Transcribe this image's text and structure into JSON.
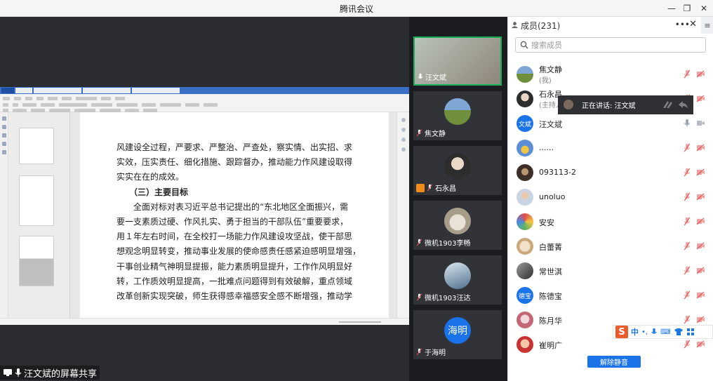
{
  "window": {
    "title": "腾讯会议",
    "minimize_glyph": "—",
    "restore_glyph": "❐",
    "close_glyph": "✕"
  },
  "share": {
    "label": "汪文斌的屏幕共享"
  },
  "document": {
    "lines": [
      {
        "text": "风建设全过程，严要求、严整治、严查处，察实情、出实招、求",
        "bold": false
      },
      {
        "text": "实效，压实责任、细化措施、跟踪督办，推动能力作风建设取得",
        "bold": false
      },
      {
        "text": "实实在在的成效。",
        "bold": false
      },
      {
        "text": "　　（三）主要目标",
        "bold": true
      },
      {
        "text": "　　全面对标对表习近平总书记提出的“东北地区全面振兴，需",
        "bold": false
      },
      {
        "text": "要一支素质过硬、作风扎实、勇于担当的干部队伍”重要要求，",
        "bold": false
      },
      {
        "text": "用１年左右时间，在全校打一场能力作风建设攻坚战，使干部思",
        "bold": false
      },
      {
        "text": "想观念明显转变，推动事业发展的使命感责任感紧迫感明显增强，",
        "bold": false
      },
      {
        "text": "干事创业精气神明显提振，能力素质明显提升，工作作风明显好",
        "bold": false
      },
      {
        "text": "转，工作质效明显提高，一批难点问题得到有效破解，重点领域",
        "bold": false
      },
      {
        "text": "改革创新实现突破，师生获得感幸福感安全感不断增强，推动学",
        "bold": false
      }
    ]
  },
  "videos": [
    {
      "name": "汪文斌",
      "icon": "mic-icon",
      "active": true
    },
    {
      "name": "焦文静",
      "icon": "mic-muted-icon",
      "active": false
    },
    {
      "name": "石永昌",
      "icon": "mic-muted-icon",
      "active": false,
      "badge": "share-icon"
    },
    {
      "name": "微机1903李畅",
      "icon": "mic-muted-icon",
      "active": false
    },
    {
      "name": "微机1903汪达",
      "icon": "mic-muted-icon",
      "active": false
    },
    {
      "name": "于海明",
      "icon": "mic-muted-icon",
      "active": false,
      "avatar_text": "海明"
    }
  ],
  "panel": {
    "title": "成员(231)",
    "more": "•••",
    "close": "✕",
    "side_toggle": "≡",
    "search_placeholder": "搜索成员",
    "unmute_label": "解除静音",
    "speaking_label": "正在讲话: 汪文斌",
    "members": [
      {
        "name": "焦文静",
        "sub": "(我)",
        "avatar": "photo-field",
        "mic": "muted"
      },
      {
        "name": "石永昌",
        "sub": "(主持人)",
        "avatar": "photo-person-f",
        "mic": "muted"
      },
      {
        "name": "汪文斌",
        "sub": "",
        "avatar": "text",
        "avatar_text": "文斌",
        "mic": "active"
      },
      {
        "name": "......",
        "sub": "",
        "avatar": "photo-cartoon",
        "mic": "muted"
      },
      {
        "name": "093113-2",
        "sub": "",
        "avatar": "photo-dark",
        "mic": "muted"
      },
      {
        "name": "unoluo",
        "sub": "",
        "avatar": "photo-person-m",
        "mic": "muted"
      },
      {
        "name": "安安",
        "sub": "",
        "avatar": "photo-colorful",
        "mic": "muted"
      },
      {
        "name": "白蕾菁",
        "sub": "",
        "avatar": "photo-beige",
        "mic": "muted"
      },
      {
        "name": "常世淇",
        "sub": "",
        "avatar": "photo-grey",
        "mic": "muted"
      },
      {
        "name": "陈德宝",
        "sub": "",
        "avatar": "text",
        "avatar_text": "德宝",
        "mic": "muted"
      },
      {
        "name": "陈月华",
        "sub": "",
        "avatar": "photo-pink",
        "mic": "muted"
      },
      {
        "name": "崔明广",
        "sub": "",
        "avatar": "photo-red",
        "mic": "muted"
      }
    ]
  },
  "ime": {
    "logo": "S",
    "mode": "中",
    "punct": "•,",
    "keyboard": "⌨"
  },
  "colors": {
    "accent": "#1a73e8",
    "muted_red": "#e05656",
    "active_green": "#18b057"
  }
}
